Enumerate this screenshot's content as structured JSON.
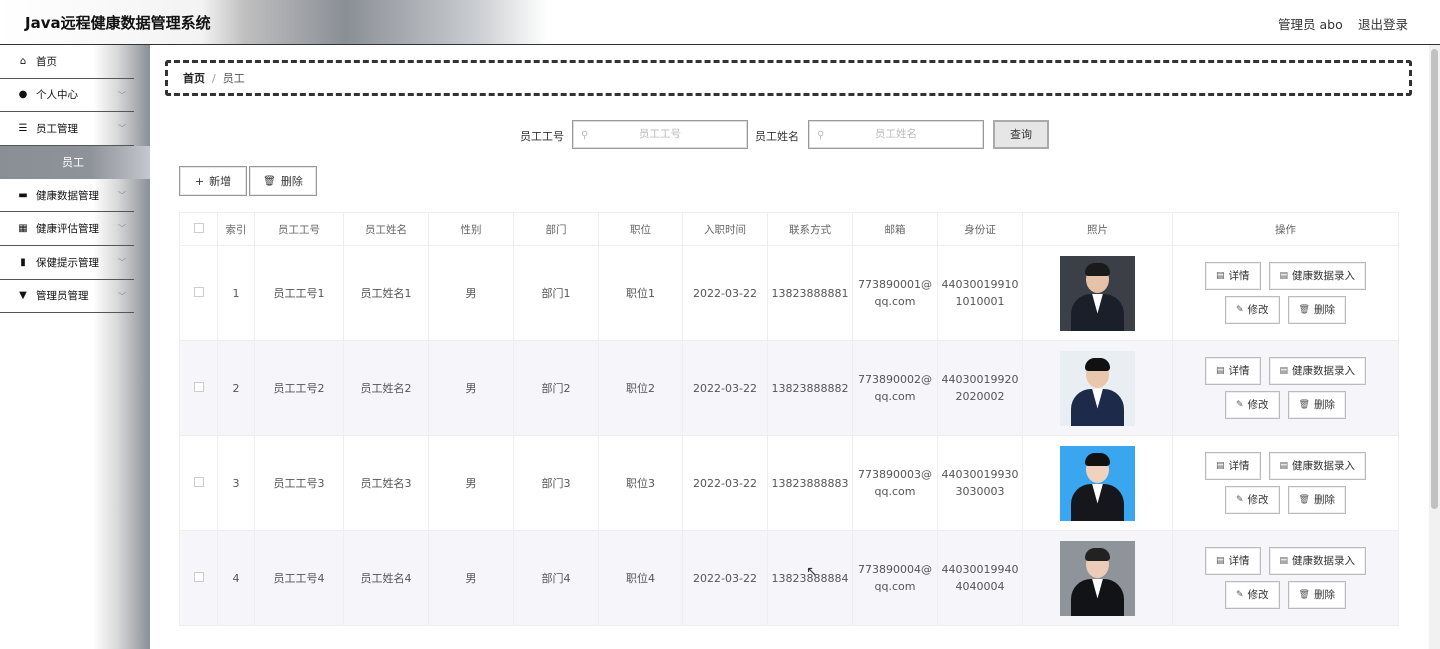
{
  "header": {
    "title": "Java远程健康数据管理系统",
    "user": "管理员 abo",
    "logout": "退出登录"
  },
  "sidebar": {
    "items": [
      {
        "icon": "home-icon",
        "glyph": "⌂",
        "label": "首页",
        "chevron": false
      },
      {
        "icon": "user-icon",
        "glyph": "●",
        "label": "个人中心",
        "chevron": true
      },
      {
        "icon": "list-icon",
        "glyph": "☰",
        "label": "员工管理",
        "chevron": true
      },
      {
        "icon": "briefcase-icon",
        "glyph": "▬",
        "label": "健康数据管理",
        "chevron": true
      },
      {
        "icon": "grid-icon",
        "glyph": "▦",
        "label": "健康评估管理",
        "chevron": true
      },
      {
        "icon": "doc-icon",
        "glyph": "▮",
        "label": "保健提示管理",
        "chevron": true
      },
      {
        "icon": "tag-icon",
        "glyph": "▼",
        "label": "管理员管理",
        "chevron": true
      }
    ],
    "sub_item": "员工"
  },
  "breadcrumb": {
    "home": "首页",
    "sep": "/",
    "current": "员工"
  },
  "search": {
    "field1_label": "员工工号",
    "field1_placeholder": "员工工号",
    "field2_label": "员工姓名",
    "field2_placeholder": "员工姓名",
    "button": "查询"
  },
  "toolbar": {
    "add": "新增",
    "delete": "删除"
  },
  "table": {
    "headers": [
      "",
      "索引",
      "员工工号",
      "员工姓名",
      "性别",
      "部门",
      "职位",
      "入职时间",
      "联系方式",
      "邮箱",
      "身份证",
      "照片",
      "操作"
    ],
    "rows": [
      {
        "index": "1",
        "no": "员工工号1",
        "name": "员工姓名1",
        "gender": "男",
        "dept": "部门1",
        "pos": "职位1",
        "date": "2022-03-22",
        "phone": "13823888881",
        "email1": "773890001@",
        "email2": "qq.com",
        "id1": "44030019910",
        "id2": "1010001"
      },
      {
        "index": "2",
        "no": "员工工号2",
        "name": "员工姓名2",
        "gender": "男",
        "dept": "部门2",
        "pos": "职位2",
        "date": "2022-03-22",
        "phone": "13823888882",
        "email1": "773890002@",
        "email2": "qq.com",
        "id1": "44030019920",
        "id2": "2020002"
      },
      {
        "index": "3",
        "no": "员工工号3",
        "name": "员工姓名3",
        "gender": "男",
        "dept": "部门3",
        "pos": "职位3",
        "date": "2022-03-22",
        "phone": "13823888883",
        "email1": "773890003@",
        "email2": "qq.com",
        "id1": "44030019930",
        "id2": "3030003"
      },
      {
        "index": "4",
        "no": "员工工号4",
        "name": "员工姓名4",
        "gender": "男",
        "dept": "部门4",
        "pos": "职位4",
        "date": "2022-03-22",
        "phone": "13823888884",
        "email1": "773890004@",
        "email2": "qq.com",
        "id1": "44030019940",
        "id2": "4040004"
      }
    ],
    "actions": {
      "detail": "详情",
      "health_entry": "健康数据录入",
      "edit": "修改",
      "delete": "删除"
    }
  },
  "colors": {
    "row_alt": "#f5f5fa",
    "border": "#eeeeee",
    "sidebar_active": "#8a8f96"
  }
}
